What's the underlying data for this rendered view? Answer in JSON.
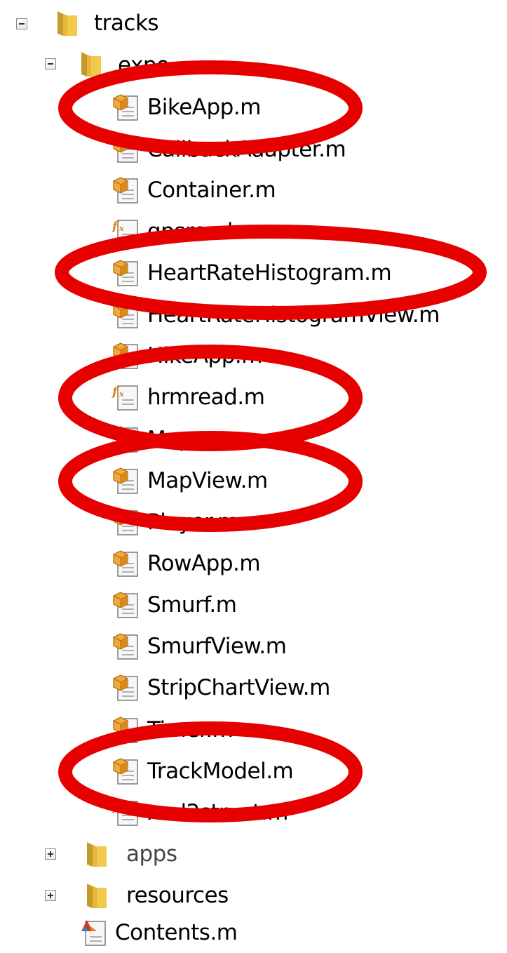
{
  "tree": {
    "root": {
      "label": "tracks"
    },
    "folder": {
      "label": "expo"
    },
    "files": [
      {
        "label": "BikeApp.m",
        "icon": "class-file-icon"
      },
      {
        "label": "CallbackAdapter.m",
        "icon": "class-file-icon"
      },
      {
        "label": "Container.m",
        "icon": "class-file-icon"
      },
      {
        "label": "gpsread.m",
        "icon": "function-file-icon"
      },
      {
        "label": "HeartRateHistogram.m",
        "icon": "class-file-icon"
      },
      {
        "label": "HeartRateHistogramView.m",
        "icon": "class-file-icon"
      },
      {
        "label": "HikeApp.m",
        "icon": "class-file-icon"
      },
      {
        "label": "hrmread.m",
        "icon": "function-file-icon"
      },
      {
        "label": "Map.m",
        "icon": "class-file-icon"
      },
      {
        "label": "MapView.m",
        "icon": "class-file-icon"
      },
      {
        "label": "Player.m",
        "icon": "class-file-icon"
      },
      {
        "label": "RowApp.m",
        "icon": "class-file-icon"
      },
      {
        "label": "Smurf.m",
        "icon": "class-file-icon"
      },
      {
        "label": "SmurfView.m",
        "icon": "class-file-icon"
      },
      {
        "label": "StripChartView.m",
        "icon": "class-file-icon"
      },
      {
        "label": "Timer.m",
        "icon": "class-file-icon"
      },
      {
        "label": "TrackModel.m",
        "icon": "class-file-icon"
      },
      {
        "label": "xml2struct.m",
        "icon": "function-file-icon"
      }
    ],
    "apps": {
      "label": "apps"
    },
    "resources": {
      "label": "resources"
    },
    "contents": {
      "label": "Contents.m",
      "icon": "contents-file-icon"
    }
  },
  "colors": {
    "highlight_ring": "#e60000",
    "folder_yellow": "#f2c94c",
    "class_orange": "#e89a2c"
  }
}
